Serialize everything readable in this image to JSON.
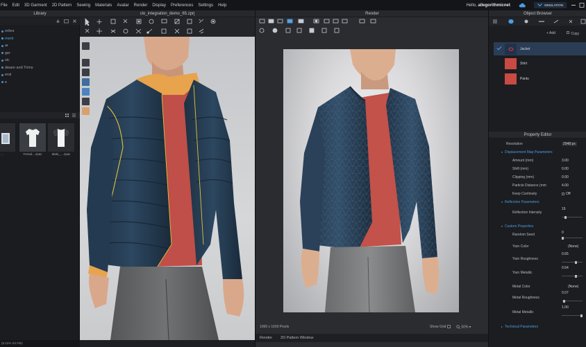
{
  "menu": {
    "items": [
      "File",
      "Edit",
      "3D Garment",
      "2D Pattern",
      "Sewing",
      "Materials",
      "Avatar",
      "Render",
      "Display",
      "Preferences",
      "Settings",
      "Help"
    ],
    "greeting_prefix": "Hello,",
    "username": "allegorithmicnet",
    "mode": "SIMULATION"
  },
  "library": {
    "title": "Library",
    "tree": [
      "orites",
      "ment",
      "ar",
      "ger",
      "sic",
      "dware and Trims",
      "eral",
      "e"
    ],
    "thumbnails": [
      {
        "caption": "..."
      },
      {
        "caption": "Femal....zpac"
      },
      {
        "caption": "Male_....zpac"
      }
    ],
    "status": "(8.22% 0/1795)"
  },
  "viewport3d": {
    "title": "clo_integration_demo_65.zprj"
  },
  "render": {
    "title": "Render",
    "resolution_text": "1066 x 1600 Pixels",
    "show_grid_label": "Show Grid",
    "zoom": "50%",
    "tabs": [
      "Render",
      "2D Pattern Window"
    ]
  },
  "object_browser": {
    "title": "Object Browser",
    "add_label": "Add",
    "copy_label": "Copy",
    "items": [
      {
        "label": "Jacket",
        "color": "#20324a",
        "selected": true
      },
      {
        "label": "Shirt",
        "color": "#c94a44",
        "selected": false
      },
      {
        "label": "Pants",
        "color": "#c94a44",
        "selected": false
      }
    ]
  },
  "property_editor": {
    "title": "Property Editor",
    "resolution_label": "Resolution",
    "resolution_value": "2048 px",
    "displacement_title": "Displacement Map Parameters",
    "amount_label": "Amount (mm)",
    "amount_value": "3.00",
    "shift_label": "Shift (mm)",
    "shift_value": "0.00",
    "clipping_label": "Clipping (mm)",
    "clipping_value": "0.00",
    "particle_label": "Particle Distance (mm",
    "particle_value": "4.00",
    "keep_label": "Keep Continuity",
    "keep_value": "Off",
    "reflection_title": "Reflection Parameters",
    "reflection_label": "Reflection Intensity",
    "reflection_value": "15",
    "custom_title": "Custom Properties",
    "seed_label": "Random Seed",
    "seed_value": "0",
    "yarn_color_label": "Yarn Color",
    "yarn_color_value": "(None)",
    "yarn_rough_label": "Yarn Roughness",
    "yarn_rough_value": "0.65",
    "yarn_metal_label": "Yarn Metallic",
    "yarn_metal_value": "0.64",
    "metal_color_label": "Metal Color",
    "metal_color_value": "(None)",
    "metal_rough_label": "Metal Roughness",
    "metal_rough_value": "0.07",
    "metal_metal_label": "Metal Metallic",
    "metal_metal_value": "1.00",
    "technical_title": "Technical Parameters"
  }
}
